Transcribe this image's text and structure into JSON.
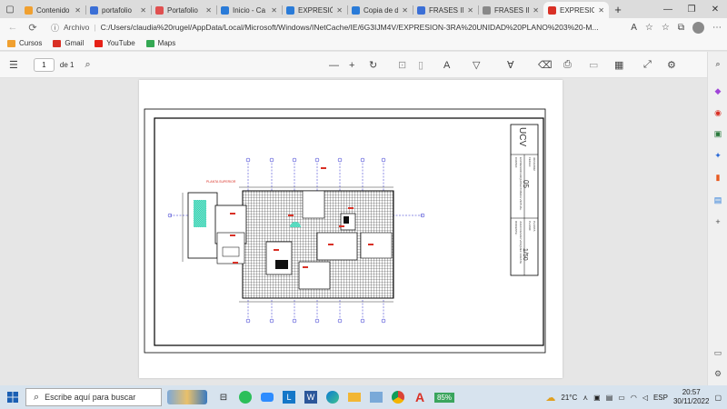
{
  "tabs": [
    {
      "label": "Contenido",
      "icon_color": "#f0a030",
      "icon": "folder-icon"
    },
    {
      "label": "portafolio",
      "icon_color": "#3b6fd6",
      "icon": "search-icon"
    },
    {
      "label": "Portafolio",
      "icon_color": "#e05050",
      "icon": "page-icon"
    },
    {
      "label": "Inicio - Ca",
      "icon_color": "#2a7bd8",
      "icon": "globe-icon"
    },
    {
      "label": "EXPRESIÓN",
      "icon_color": "#2a7bd8",
      "icon": "globe-icon"
    },
    {
      "label": "Copia de d",
      "icon_color": "#2a7bd8",
      "icon": "globe-icon"
    },
    {
      "label": "FRASES IN",
      "icon_color": "#3b6fd6",
      "icon": "search-icon"
    },
    {
      "label": "FRASES IN",
      "icon_color": "#888888",
      "icon": "page-icon"
    },
    {
      "label": "EXPRESION",
      "icon_color": "#d93025",
      "icon": "pdf-icon",
      "active": true
    }
  ],
  "address": {
    "label": "Archivo",
    "url": "C:/Users/claudia%20rugel/AppData/Local/Microsoft/Windows/INetCache/IE/6G3IJM4V/EXPRESION-3RA%20UNIDAD%20PLANO%203%20-M..."
  },
  "bookmarks": [
    {
      "label": "Cursos",
      "color": "#f0a030"
    },
    {
      "label": "Gmail",
      "color": "#d93025"
    },
    {
      "label": "YouTube",
      "color": "#e62117"
    },
    {
      "label": "Maps",
      "color": "#34a853"
    }
  ],
  "pdf": {
    "page_number": "1",
    "page_of": "de 1"
  },
  "plan": {
    "floor_label": "PLANTA SUPERIOR",
    "logo": "UCV",
    "sheet": "05",
    "scale": "1/50",
    "project_label": "CURSO:",
    "project": "EXPRESION ARQUITECTONICA VIRTUAL",
    "student_label": "DOCENTE:",
    "student": "JULIO CESAR VASQUEZ ZARATE",
    "date_label": "FECHA:",
    "date": "30/11/2022",
    "plan_label": "PLANO:",
    "plan_name": "PLANTA",
    "sheet_label": "LAMINA:"
  },
  "taskbar": {
    "search_placeholder": "Escribe aquí para buscar",
    "battery": "85%",
    "weather": "21°C",
    "lang": "ESP",
    "time": "20:57",
    "date": "30/11/2022"
  },
  "colors": {
    "accent_red": "#d93025",
    "hatch_green": "#2fd1b0",
    "axis_blue": "#2222cc"
  }
}
